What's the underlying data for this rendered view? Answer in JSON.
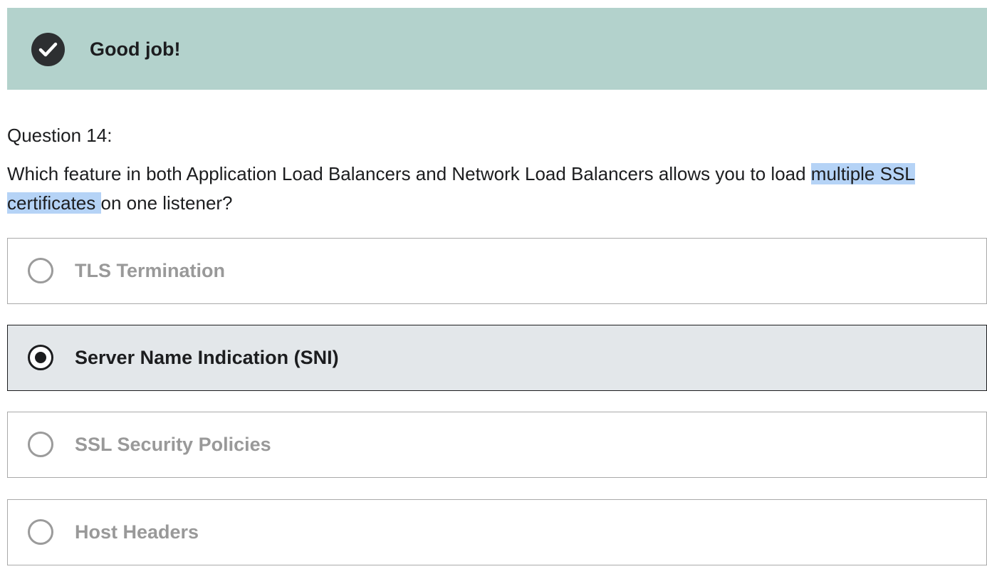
{
  "feedback": {
    "icon": "check-circle-icon",
    "message": "Good job!",
    "background_color": "#b3d2cc"
  },
  "question": {
    "number_label": "Question 14:",
    "text_before": "Which feature in both Application Load Balancers and Network Load Balancers allows you to load ",
    "text_highlighted": "multiple SSL certificates ",
    "text_after": "on one listener?"
  },
  "options": [
    {
      "label": "TLS Termination",
      "selected": false
    },
    {
      "label": "Server Name Indication (SNI)",
      "selected": true
    },
    {
      "label": "SSL Security Policies",
      "selected": false
    },
    {
      "label": "Host Headers",
      "selected": false
    }
  ]
}
